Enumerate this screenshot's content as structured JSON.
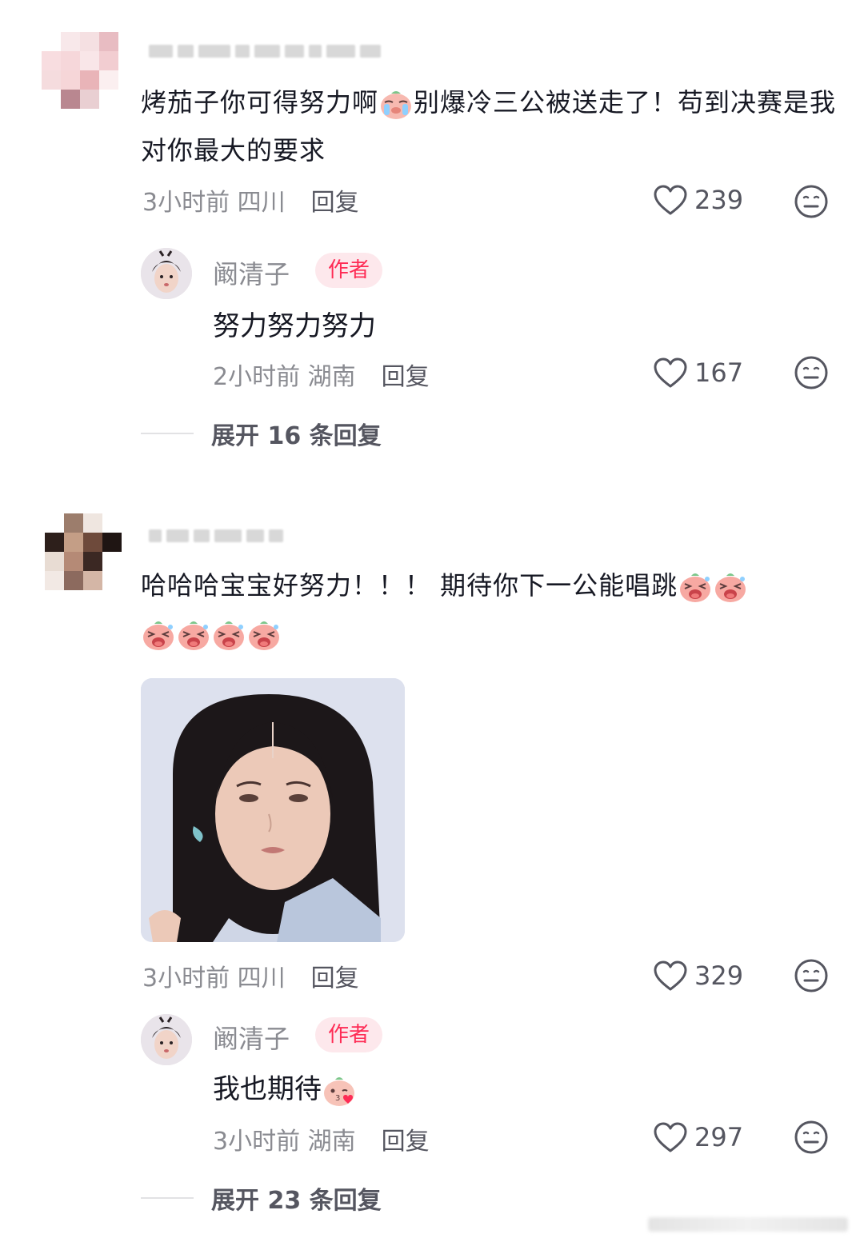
{
  "comments": [
    {
      "text_part1": "烤茄子你可得努力啊",
      "emoji1": "crying-pig-emoji",
      "text_part2": "别爆冷三公被送走了！苟到决赛是我对你最大的要求",
      "time": "3小时前",
      "location": "四川",
      "reply_label": "回复",
      "likes": "239",
      "author_reply": {
        "name": "阚清子",
        "badge": "作者",
        "text": "努力努力努力",
        "time": "2小时前",
        "location": "湖南",
        "reply_label": "回复",
        "likes": "167"
      },
      "expand_label": "展开 16 条回复"
    },
    {
      "text": "哈哈哈宝宝好努力！！！ 期待你下一公能唱跳",
      "emoji": "laughing-pig-emoji",
      "image": "photo-of-woman",
      "time": "3小时前",
      "location": "四川",
      "reply_label": "回复",
      "likes": "329",
      "author_reply": {
        "name": "阚清子",
        "badge": "作者",
        "text": "我也期待",
        "emoji": "kissing-pig-emoji",
        "time": "3小时前",
        "location": "湖南",
        "reply_label": "回复",
        "likes": "297"
      },
      "expand_label": "展开 23 条回复"
    }
  ],
  "colors": {
    "text": "#161823",
    "meta": "#8a8b91",
    "badge_text": "#fe2c55",
    "badge_bg": "#fde8ec"
  }
}
